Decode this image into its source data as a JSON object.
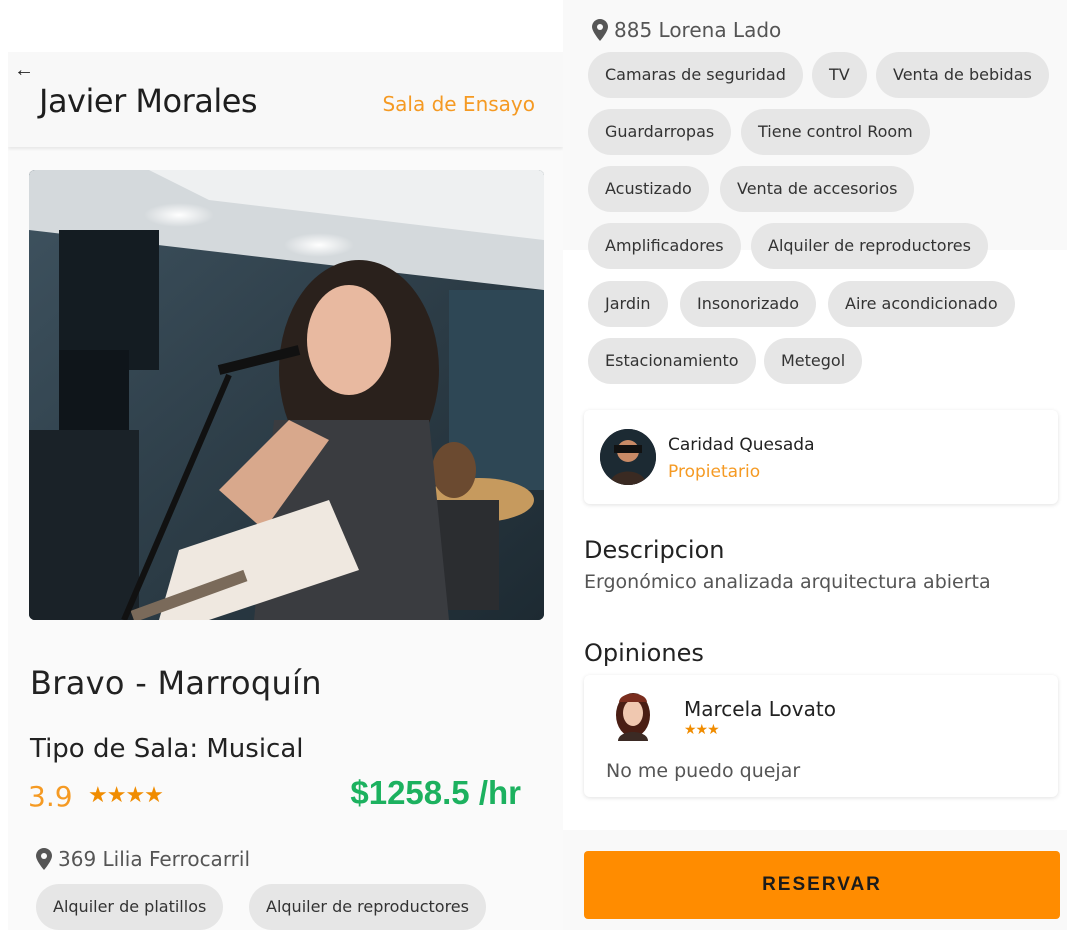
{
  "header": {
    "back_icon": "arrow-left-icon",
    "owner_name": "Javier Morales",
    "category": "Sala de Ensayo"
  },
  "venue": {
    "name": "Bravo - Marroquín",
    "type": "Tipo de Sala: Musical",
    "rating": "3.9",
    "rating_stars": "★★★★",
    "rating_value": 3.9,
    "price": "$1258.5 /hr",
    "address_main": "369 Lilia Ferrocarril",
    "address_secondary": "885 Lorena Lado",
    "pin_icon": "map-pin-icon",
    "accent_color": "#f59a23",
    "price_color": "#1cb15f"
  },
  "left_amenities": [
    "Alquiler de platillos",
    "Alquiler de reproductores"
  ],
  "right_amenities": [
    "Camaras de seguridad",
    "TV",
    "Venta de bebidas",
    "Guardarropas",
    "Tiene control Room",
    "Acustizado",
    "Venta de accesorios",
    "Amplificadores",
    "Alquiler de reproductores",
    "Jardin",
    "Insonorizado",
    "Aire acondicionado",
    "Estacionamiento",
    "Metegol"
  ],
  "owner": {
    "name": "Caridad Quesada",
    "role": "Propietario"
  },
  "description": {
    "title": "Descripcion",
    "text": "Ergonómico analizada arquitectura abierta"
  },
  "reviews": {
    "title": "Opiniones",
    "items": [
      {
        "author": "Marcela Lovato",
        "stars": "★★★",
        "rating": 3,
        "text": "No me puedo quejar"
      }
    ]
  },
  "actions": {
    "reserve_label": "RESERVAR",
    "reserve_color": "#ff8c00"
  }
}
